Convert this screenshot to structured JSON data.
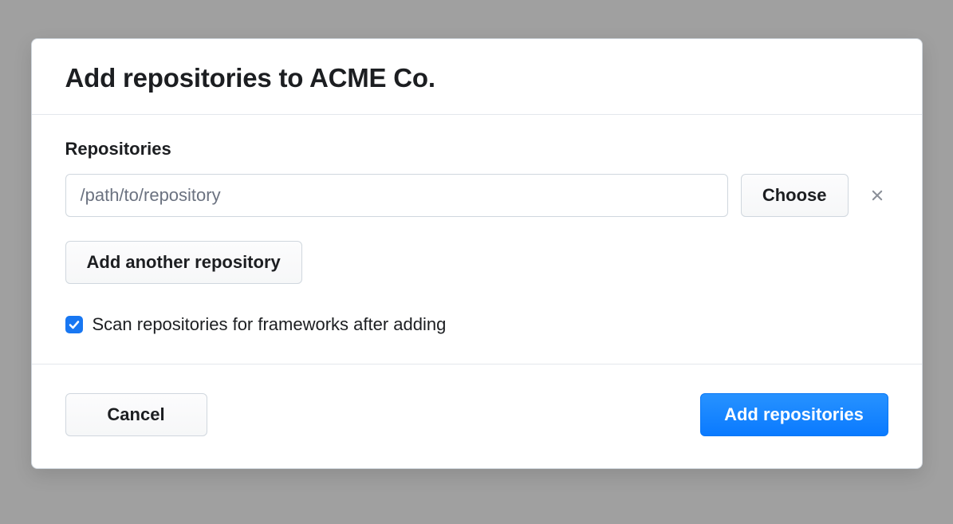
{
  "dialog": {
    "title": "Add repositories to ACME Co.",
    "section_label": "Repositories",
    "repo_input": {
      "placeholder": "/path/to/repository",
      "value": ""
    },
    "choose_button": "Choose",
    "add_another_button": "Add another repository",
    "scan_checkbox": {
      "checked": true,
      "label": "Scan repositories for frameworks after adding"
    },
    "cancel_button": "Cancel",
    "submit_button": "Add repositories"
  },
  "colors": {
    "primary": "#1877f2",
    "button_primary": "#0a7aff",
    "border": "#d0d7de",
    "text": "#1c1e21"
  }
}
